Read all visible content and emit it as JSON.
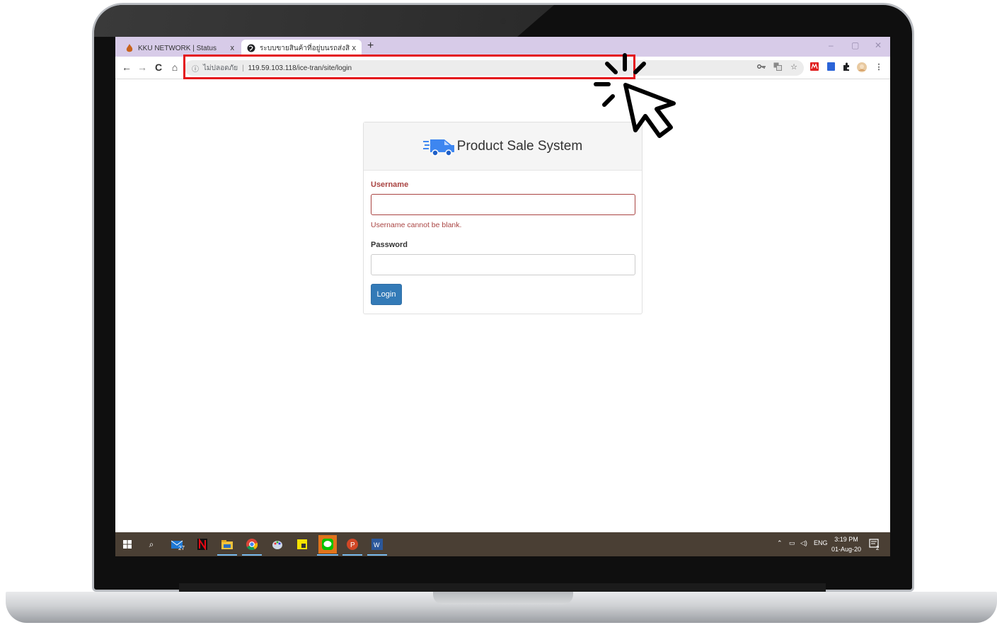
{
  "browser": {
    "tabs": [
      {
        "title": "KKU NETWORK | Status",
        "close": "x",
        "active": false
      },
      {
        "title": "ระบบขายสินค้าที่อยู่บนรถส่งสินค้า - เว",
        "close": "x",
        "active": true
      }
    ],
    "new_tab": "+",
    "window_controls": {
      "minimize": "–",
      "restore": "▢",
      "close": "✕"
    },
    "nav": {
      "back": "←",
      "forward": "→",
      "reload": "C",
      "home": "⌂"
    },
    "address": {
      "security": "ไม่ปลอดภัย",
      "separator": "|",
      "url": "119.59.103.118/ice-tran/site/login"
    },
    "toolbar_icons": [
      "key-icon",
      "translate-icon",
      "star-icon",
      "extension-red-icon",
      "extension-blue-icon",
      "puzzle-icon",
      "profile-avatar-icon",
      "menu-icon"
    ],
    "highlight_color": "#e4141b"
  },
  "login": {
    "app_title": "Product Sale System",
    "username_label": "Username",
    "username_value": "",
    "username_error": "Username cannot be blank.",
    "password_label": "Password",
    "password_value": "",
    "login_button": "Login",
    "accent_color": "#337ab7",
    "error_color": "#a94442"
  },
  "taskbar": {
    "badge_count": "27",
    "tray_lang": "ENG",
    "time": "3:19 PM",
    "date": "01-Aug-20",
    "notification_count": "2"
  }
}
